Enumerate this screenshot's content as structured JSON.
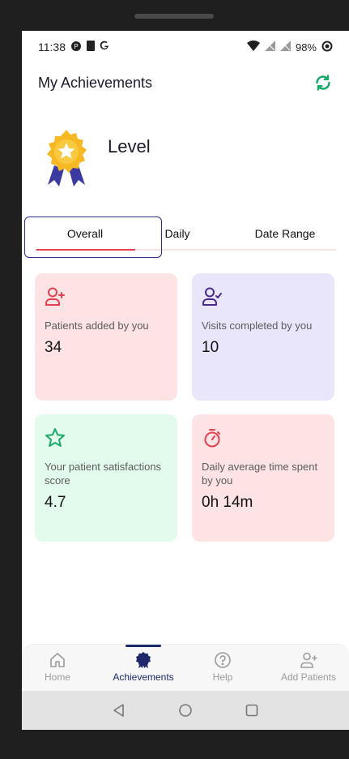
{
  "status_bar": {
    "time": "11:38",
    "battery": "98%"
  },
  "header": {
    "title": "My Achievements"
  },
  "level": {
    "label": "Level"
  },
  "tabs": [
    {
      "label": "Overall"
    },
    {
      "label": "Daily"
    },
    {
      "label": "Date Range"
    }
  ],
  "cards": [
    {
      "label": "Patients added by you",
      "value": "34",
      "icon": "user-add-icon",
      "color": "#e5404f"
    },
    {
      "label": "Visits completed by you",
      "value": "10",
      "icon": "user-check-icon",
      "color": "#4b2a8f"
    },
    {
      "label": "Your patient satisfactions score",
      "value": "4.7",
      "icon": "star-icon",
      "color": "#1aa867"
    },
    {
      "label": "Daily average time spent by you",
      "value": "0h 14m",
      "icon": "stopwatch-icon",
      "color": "#e5404f"
    }
  ],
  "bottom_nav": {
    "items": [
      {
        "label": "Home",
        "icon": "home-icon"
      },
      {
        "label": "Achievements",
        "icon": "badge-icon"
      },
      {
        "label": "Help",
        "icon": "help-icon"
      },
      {
        "label": "Add Patients",
        "icon": "user-add-icon"
      }
    ],
    "active": "Achievements"
  },
  "colors": {
    "accent": "#e5404f",
    "primary": "#1e2a6b",
    "refresh": "#1aa867"
  }
}
